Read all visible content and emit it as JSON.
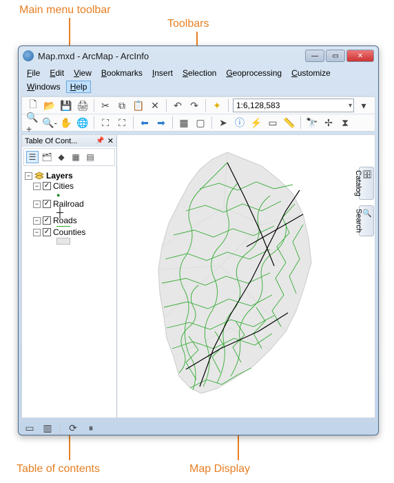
{
  "annotations": {
    "main_menu": "Main menu toolbar",
    "toolbars": "Toolbars",
    "toc": "Table of contents",
    "map_display": "Map Display"
  },
  "window": {
    "title": "Map.mxd - ArcMap - ArcInfo"
  },
  "menubar": {
    "items": [
      "File",
      "Edit",
      "View",
      "Bookmarks",
      "Insert",
      "Selection",
      "Geoprocessing",
      "Customize",
      "Windows",
      "Help"
    ],
    "selected": "Help"
  },
  "toolbar": {
    "scale": "1:6,128,583"
  },
  "icons": {
    "new": "new-icon",
    "open": "open-icon",
    "save": "save-icon",
    "print": "print-icon",
    "cut": "cut-icon",
    "copy": "copy-icon",
    "paste": "paste-icon",
    "delete": "delete-icon",
    "undo": "undo-icon",
    "redo": "redo-icon",
    "add_data": "add-data-icon",
    "zoom_in": "zoom-in-icon",
    "zoom_out": "zoom-out-icon",
    "pan": "pan-icon",
    "full_extent": "full-extent-icon",
    "fixed_zoom_in": "fixed-zoom-in-icon",
    "fixed_zoom_out": "fixed-zoom-out-icon",
    "back": "back-icon",
    "forward": "forward-icon",
    "select_features": "select-features-icon",
    "clear_selection": "clear-selection-icon",
    "select_elements": "select-elements-icon",
    "identify": "identify-icon",
    "hyperlink": "hyperlink-icon",
    "html_popup": "html-popup-icon",
    "measure": "measure-icon",
    "find": "find-icon",
    "go_to_xy": "go-to-xy-icon",
    "time_slider": "time-slider-icon"
  },
  "toc": {
    "title": "Table Of Cont...",
    "group_name": "Layers",
    "layers": [
      {
        "name": "Cities",
        "checked": true,
        "symbol_type": "point",
        "color": "#1a8a1a"
      },
      {
        "name": "Railroad",
        "checked": true,
        "symbol_type": "cross",
        "color": "#000000"
      },
      {
        "name": "Roads",
        "checked": true,
        "symbol_type": "line",
        "color": "#2aa82a"
      },
      {
        "name": "Counties",
        "checked": true,
        "symbol_type": "fill",
        "color": "#e7e7e7"
      }
    ]
  },
  "side_tabs": {
    "catalog": "Catalog",
    "search": "Search"
  },
  "chart_data": {
    "type": "map",
    "region": "Maine (US state)",
    "layers_visible": [
      "Cities",
      "Railroad",
      "Roads",
      "Counties"
    ],
    "symbology": {
      "Counties": {
        "fill": "#e7e7e7"
      },
      "Roads": {
        "stroke": "#2aa82a"
      },
      "Railroad": {
        "stroke": "#000000"
      },
      "Cities": {
        "marker": "#1a8a1a"
      }
    }
  }
}
